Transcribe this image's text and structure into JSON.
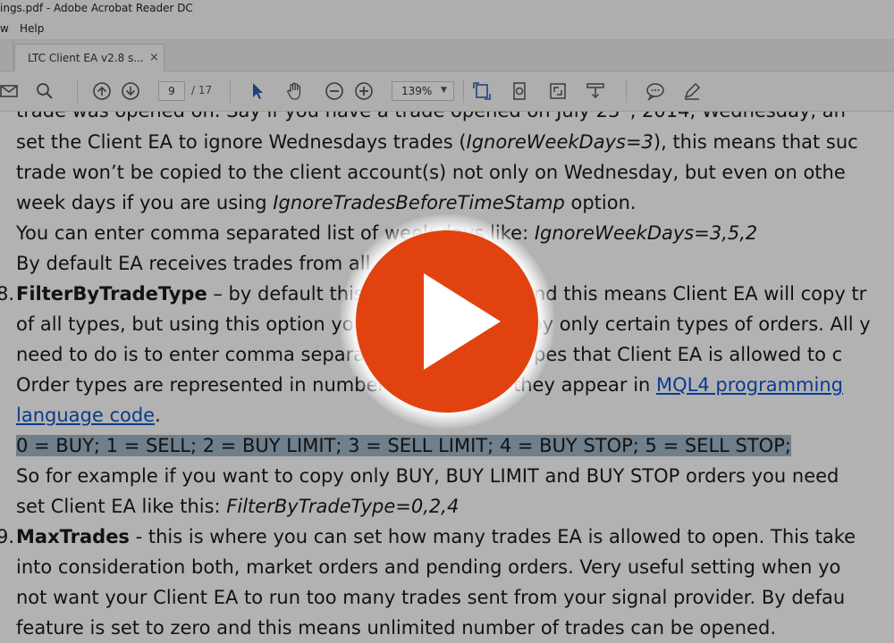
{
  "window": {
    "title": "ings.pdf - Adobe Acrobat Reader DC"
  },
  "menu": {
    "items": [
      "w",
      "Help"
    ]
  },
  "tab": {
    "label": "LTC Client EA v2.8 s...",
    "close": "×"
  },
  "toolbar": {
    "page_current": "9",
    "page_total": "/ 17",
    "zoom": "139%",
    "icons": [
      "mail-icon",
      "search-icon",
      "page-up-icon",
      "page-down-icon",
      "select-cursor-icon",
      "hand-icon",
      "zoom-out-icon",
      "zoom-in-icon",
      "fit-page-icon",
      "rotate-icon",
      "full-screen-icon",
      "read-mode-icon",
      "comment-icon",
      "sign-icon"
    ]
  },
  "document": {
    "l1": "trade was opened on. Say if you have a trade opened on July 23",
    "l1b": ", 2014, Wednesday, an",
    "l2a": "set the Client EA to ignore Wednesdays trades (",
    "l2i": "IgnoreWeekDays=3",
    "l2b": "), this means that suc",
    "l3": "trade won’t be copied to the client account(s) not only on Wednesday, but even on othe",
    "l4a": "week days if you are using ",
    "l4i": "IgnoreTradesBeforeTimeStamp",
    "l4b": " option.",
    "l5a": "You can enter comma separated list of week days like: ",
    "l5i": "IgnoreWeekDays=3,5,2",
    "l6": "By default EA receives trades from all days.",
    "item8_num": "8.",
    "item8_title": "FilterByTradeType",
    "l7b": " – by default this option is empty and this means Client EA will copy tr",
    "l8": "of all types, but using this option you can choose to copy only certain types of orders. All y",
    "l9": "need to do is to enter comma separated list of trade types that Client EA is allowed to c",
    "l10a": "Order types are represented in numbers exactly like they appear in ",
    "l10link": "MQL4 programming",
    "l11link": "language code",
    "l11b": ".",
    "l12": "0 = BUY; 1 = SELL; 2 = BUY LIMIT; 3 = SELL LIMIT; 4 = BUY STOP; 5 = SELL STOP;",
    "l13": "So for example if you want to copy only BUY, BUY LIMIT and BUY STOP orders you need",
    "l14a": "set Client EA like this: ",
    "l14i": "FilterByTradeType=0,2,4",
    "item9_num": "9.",
    "item9_title": "MaxTrades",
    "l15b": " - this is where you can set how many trades EA is allowed to open. This take",
    "l16": "into consideration both, market orders and pending orders. Very useful setting when yo",
    "l17": "not want your Client EA to run too many trades sent from your signal provider. By defau",
    "l18": "feature is set to zero and this means unlimited number of trades can be opened."
  },
  "overlay": {
    "play_color": "#e1420f",
    "icon": "play-icon"
  }
}
